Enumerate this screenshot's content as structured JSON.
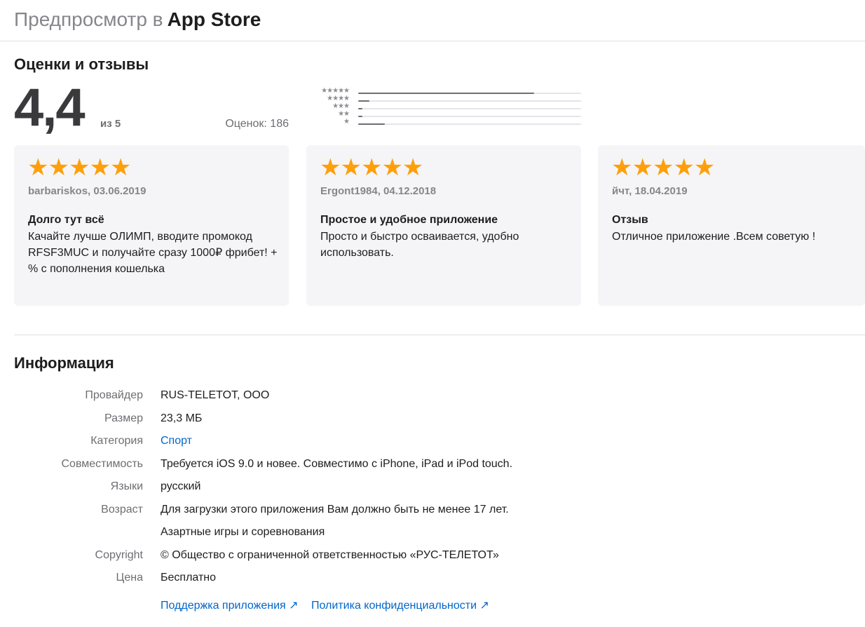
{
  "header": {
    "prefix": "Предпросмотр в",
    "brand": "App Store"
  },
  "ratings": {
    "section_title": "Оценки и отзывы",
    "score": "4,4",
    "out_of": "из 5",
    "count_label": "Оценок: 186",
    "histogram": [
      {
        "stars": "★★★★★",
        "fraction": 0.79
      },
      {
        "stars": "★★★★",
        "fraction": 0.05
      },
      {
        "stars": "★★★",
        "fraction": 0.02
      },
      {
        "stars": "★★",
        "fraction": 0.02
      },
      {
        "stars": "★",
        "fraction": 0.12
      }
    ],
    "star_color": "#ff9f0a",
    "reviews": [
      {
        "stars": "★★★★★",
        "rating": 5,
        "author_date": "barbariskos, 03.06.2019",
        "title": "Долго тут всё",
        "body": "Качайте лучше ОЛИМП, вводите промокод RFSF3MUC и получайте сразу 1000₽ фрибет! + % с пополнения кошелька"
      },
      {
        "stars": "★★★★★",
        "rating": 5,
        "author_date": "Ergont1984, 04.12.2018",
        "title": "Простое и удобное приложение",
        "body": "Просто и быстро осваивается, удобно использовать."
      },
      {
        "stars": "★★★★★",
        "rating": 5,
        "author_date": "йчт, 18.04.2019",
        "title": "Отзыв",
        "body": "Отличное приложение .Всем советую !"
      }
    ]
  },
  "info": {
    "section_title": "Информация",
    "rows": [
      {
        "label": "Провайдер",
        "value": "RUS-TELETOT, OOO"
      },
      {
        "label": "Размер",
        "value": "23,3 МБ"
      },
      {
        "label": "Категория",
        "value": "Спорт"
      },
      {
        "label": "Совместимость",
        "value": "Требуется iOS 9.0 и новее. Совместимо с iPhone, iPad и iPod touch."
      },
      {
        "label": "Языки",
        "value": "русский"
      },
      {
        "label": "Возраст",
        "value": "Для загрузки этого приложения Вам должно быть не менее 17 лет."
      },
      {
        "label": "",
        "value": "Азартные игры и соревнования"
      },
      {
        "label": "Copyright",
        "value": "© Общество с ограниченной ответственностью «РУС-ТЕЛЕТОТ»"
      },
      {
        "label": "Цена",
        "value": "Бесплатно"
      }
    ],
    "links": {
      "support": "Поддержка приложения ↗",
      "privacy": "Политика конфиденциальности ↗"
    },
    "link_color": "#0066cc"
  }
}
